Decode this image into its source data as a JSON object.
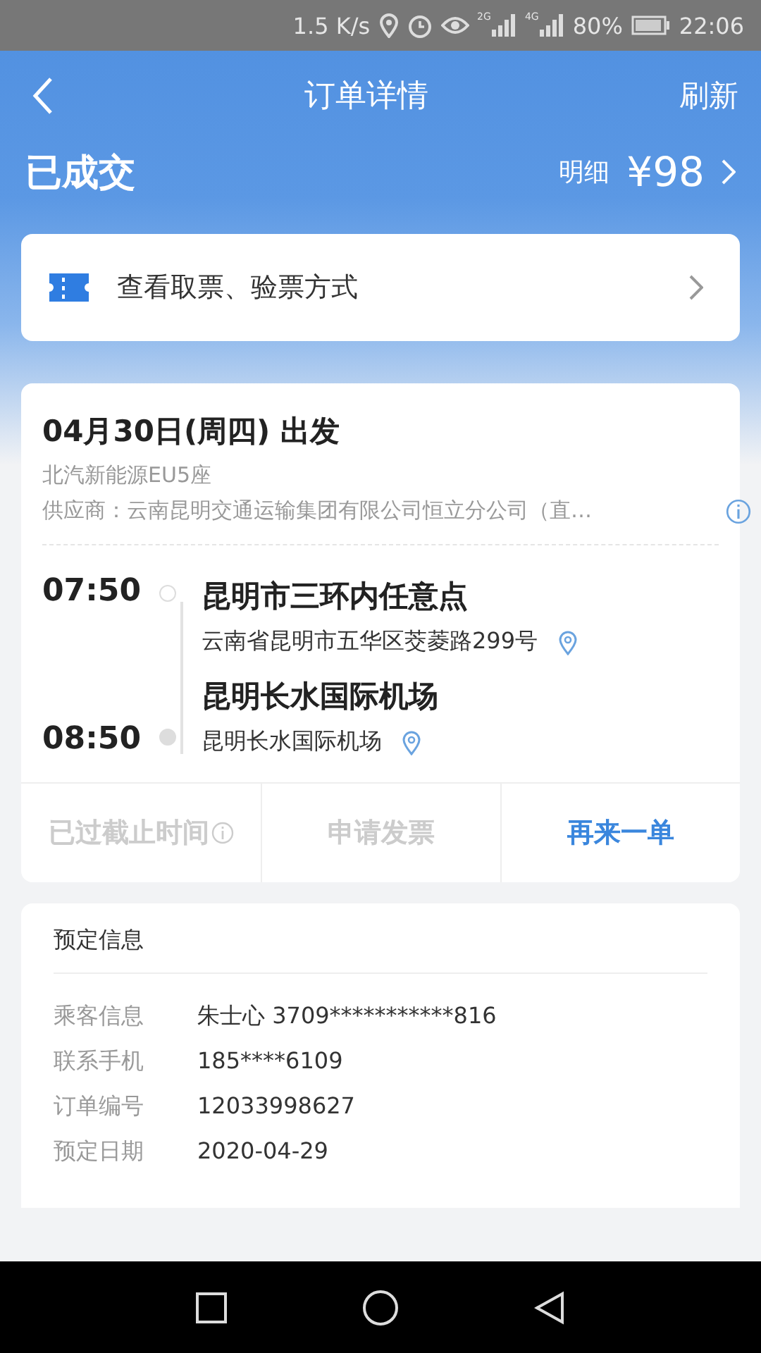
{
  "status_bar": {
    "speed": "1.5 K/s",
    "networks": [
      "2G",
      "4G"
    ],
    "battery": "80%",
    "time": "22:06"
  },
  "header": {
    "title": "订单详情",
    "action": "刷新"
  },
  "order_status": {
    "status": "已成交",
    "detail_link": "明细",
    "price": "¥98"
  },
  "ticket_link": {
    "label": "查看取票、验票方式"
  },
  "trip": {
    "date": "04月30日(周四) 出发",
    "vehicle": "北汽新能源EU5座",
    "supplier": "供应商：云南昆明交通运输集团有限公司恒立分公司（直…",
    "stops": [
      {
        "time": "07:50",
        "name": "昆明市三环内任意点",
        "address": "云南省昆明市五华区茭菱路299号"
      },
      {
        "time": "08:50",
        "name": "昆明长水国际机场",
        "address": "昆明长水国际机场"
      }
    ],
    "actions": [
      {
        "label": "已过截止时间",
        "disabled": true,
        "info": true
      },
      {
        "label": "申请发票",
        "disabled": true,
        "info": false
      },
      {
        "label": "再来一单",
        "disabled": false,
        "info": false
      }
    ]
  },
  "booking": {
    "title": "预定信息",
    "rows": [
      {
        "label": "乘客信息",
        "value": "朱士心  3709***********816"
      },
      {
        "label": "联系手机",
        "value": "185****6109"
      },
      {
        "label": "订单编号",
        "value": "12033998627"
      },
      {
        "label": "预定日期",
        "value": "2020-04-29"
      }
    ]
  }
}
